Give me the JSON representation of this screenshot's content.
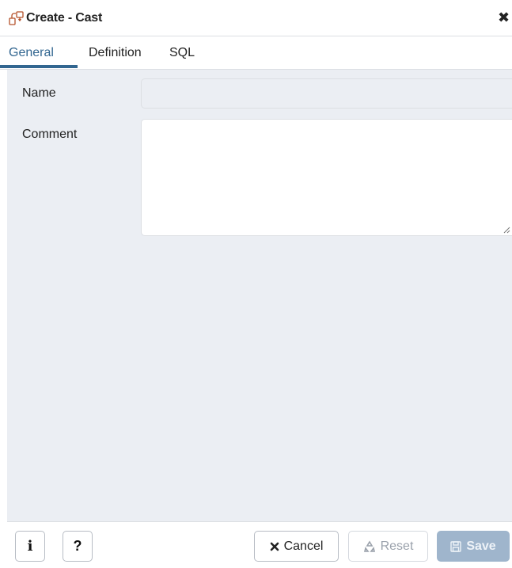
{
  "dialog": {
    "title": "Create - Cast",
    "close_glyph": "✖",
    "icon": "cast-icon"
  },
  "tabs": [
    {
      "label": "General",
      "active": true
    },
    {
      "label": "Definition",
      "active": false
    },
    {
      "label": "SQL",
      "active": false
    }
  ],
  "form": {
    "name_label": "Name",
    "name_value": "",
    "comment_label": "Comment",
    "comment_value": ""
  },
  "footer": {
    "info_glyph": "i",
    "help_glyph": "?",
    "cancel_label": "Cancel",
    "cancel_icon": "times-icon",
    "reset_label": "Reset",
    "reset_icon": "recycle-icon",
    "save_label": "Save",
    "save_icon": "floppy-icon"
  },
  "colors": {
    "accent": "#326690",
    "panel_bg": "#ebeef3",
    "save_disabled": "#9fb5cc"
  }
}
